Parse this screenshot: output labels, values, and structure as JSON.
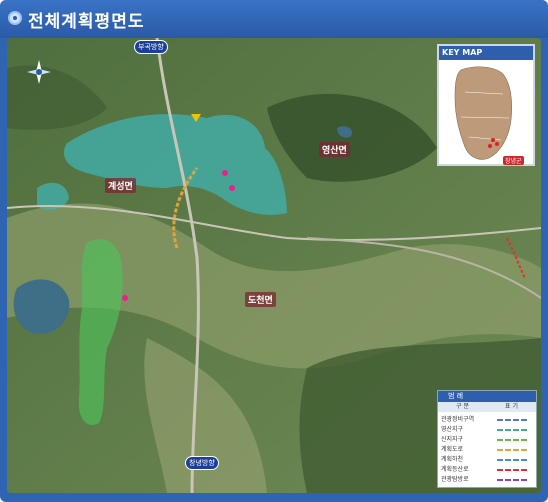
{
  "header": {
    "title": "전체계획평면도"
  },
  "map": {
    "places": [
      "영산면",
      "계성면",
      "도천면"
    ],
    "routes": [
      "부곡방향",
      "창녕방향"
    ],
    "keymap": {
      "title": "KEY MAP",
      "tag": "창녕군"
    },
    "legend": {
      "title": "범 례",
      "headers": [
        "구 분",
        "표 기"
      ],
      "rows": [
        "관광정비구역",
        "영산지구",
        "신지지구",
        "계획도로",
        "계획하천",
        "계획등산로",
        "관광탐방로"
      ]
    }
  },
  "colors": {
    "frame": "#2f64b3",
    "accent_marker": "#e8228c"
  }
}
